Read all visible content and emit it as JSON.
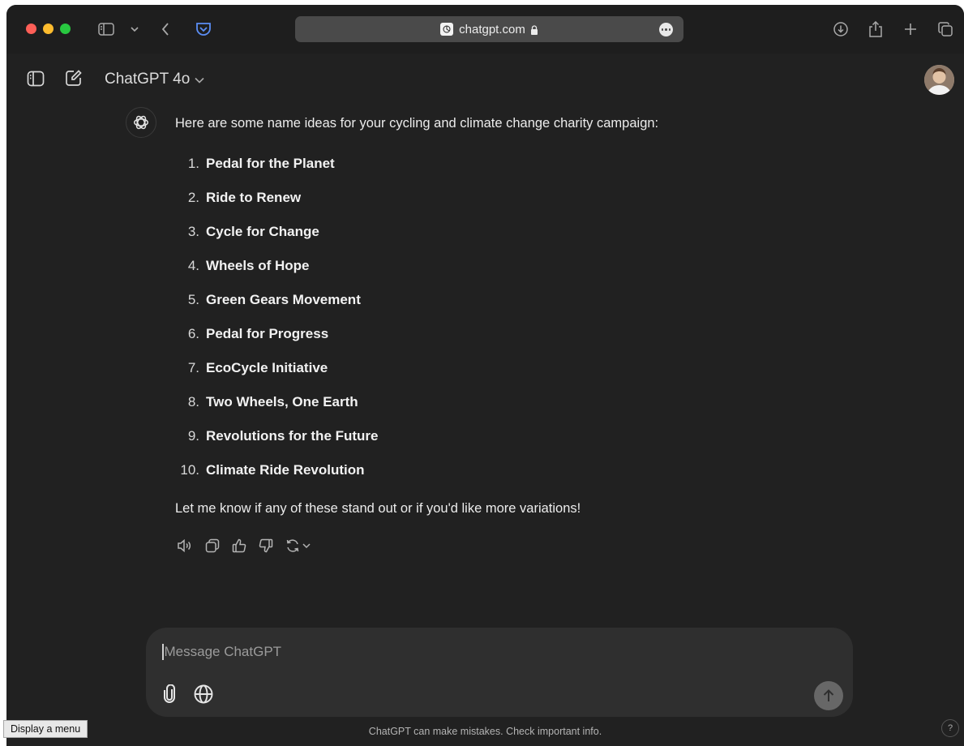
{
  "browser": {
    "url": "chatgpt.com",
    "traffic_colors": {
      "close": "#fe5f57",
      "minimize": "#febc2e",
      "zoom": "#28c840"
    },
    "toolbar_icons": [
      "sidebar-icon",
      "chevron-down-icon",
      "back-icon",
      "pocket-icon",
      "download-icon",
      "share-icon",
      "new-tab-icon",
      "tab-overview-icon"
    ]
  },
  "app": {
    "model_label": "ChatGPT 4o"
  },
  "message": {
    "intro": "Here are some name ideas for your cycling and climate change charity campaign:",
    "ideas": [
      {
        "num": "1.",
        "name": "Pedal for the Planet"
      },
      {
        "num": "2.",
        "name": "Ride to Renew"
      },
      {
        "num": "3.",
        "name": "Cycle for Change"
      },
      {
        "num": "4.",
        "name": "Wheels of Hope"
      },
      {
        "num": "5.",
        "name": "Green Gears Movement"
      },
      {
        "num": "6.",
        "name": "Pedal for Progress"
      },
      {
        "num": "7.",
        "name": "EcoCycle Initiative"
      },
      {
        "num": "8.",
        "name": "Two Wheels, One Earth"
      },
      {
        "num": "9.",
        "name": "Revolutions for the Future"
      },
      {
        "num": "10.",
        "name": "Climate Ride Revolution"
      }
    ],
    "outro": "Let me know if any of these stand out or if you'd like more variations!",
    "action_icons": [
      "read-aloud-icon",
      "copy-icon",
      "thumbs-up-icon",
      "thumbs-down-icon",
      "regenerate-icon"
    ]
  },
  "composer": {
    "placeholder": "Message ChatGPT"
  },
  "footer": {
    "note": "ChatGPT can make mistakes. Check important info.",
    "tooltip": "Display a menu",
    "help": "?"
  }
}
